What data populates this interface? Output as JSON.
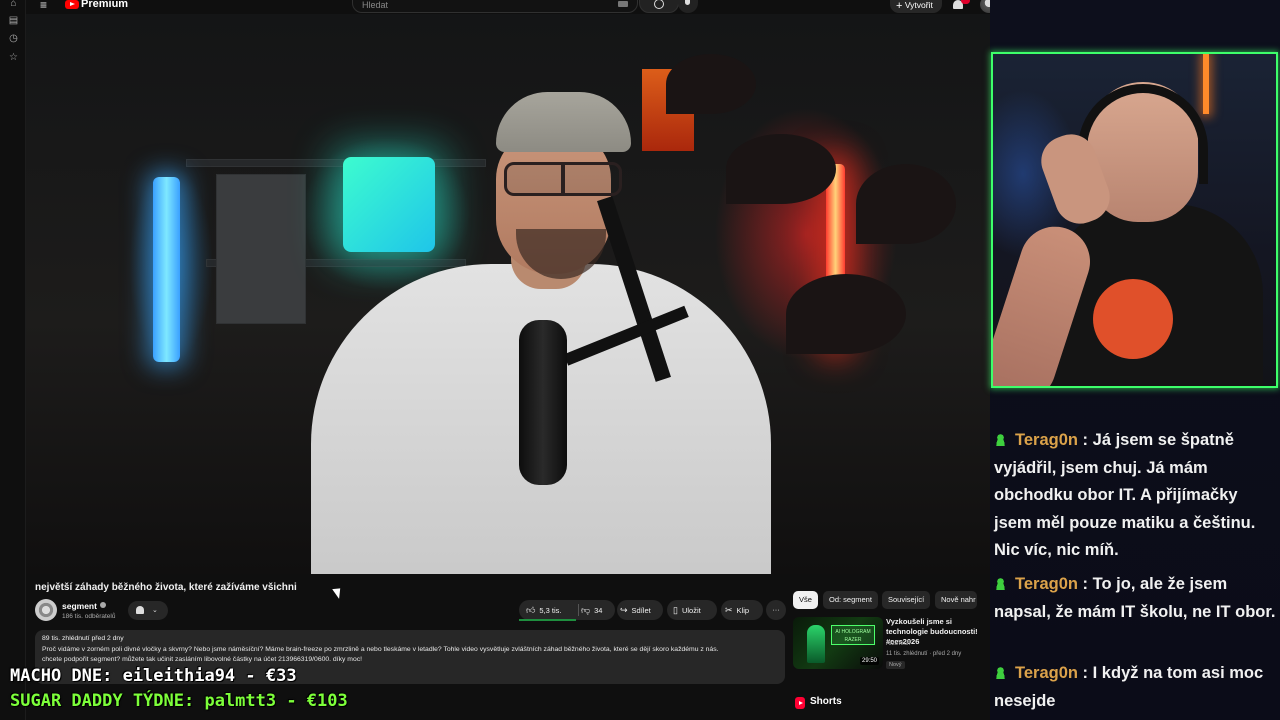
{
  "header": {
    "brand": "Premium",
    "search_placeholder": "Hledat",
    "create_label": "Vytvořit"
  },
  "video": {
    "title": "největší záhady běžného života, které zažíváme všichni",
    "channel": "segment",
    "subscribers": "186 tis. odběratelů",
    "likes": "5,3 tis.",
    "dislikes": "34",
    "share_label": "Sdílet",
    "save_label": "Uložit",
    "clip_label": "Klip",
    "description": {
      "meta": "89 tis. zhlédnutí  před 2 dny",
      "line1": "Proč vidáme v zorném poli divné vločky a skvrny? Nebo jsme náměsíční? Máme brain-freeze po zmrzlině a nebo tleskáme v letadle? Tohle video vysvětluje zvláštních záhad běžného života, které se dějí skoro každému z nás.",
      "line2": "chcete podpořit segment? můžete tak učinit zasláním libovolné částky na účet 213966319/0600. díky moc!"
    }
  },
  "recommendations": {
    "chips": [
      "Vše",
      "Od: segment",
      "Související",
      "Nově nahr"
    ],
    "active_chip": "Vše",
    "items": [
      {
        "title": "Vyzkoušeli jsme si technologie budoucnosti! #ces2026",
        "channel": "AlzaTech",
        "meta": "11 tis. zhlédnutí · před 2 dny",
        "badge": "Nový",
        "duration": "29:50",
        "thumb_text": "AI HOLOGRAM RAZER"
      }
    ],
    "shorts_label": "Shorts"
  },
  "chat": [
    {
      "user": "Terag0n",
      "message": "Já jsem se špatně vyjádřil, jsem chuj. Já mám obchodku obor IT. A přijímačky jsem měl pouze matiku a češtinu. Nic víc, nic míň."
    },
    {
      "user": "Terag0n",
      "message": "To jo, ale že jsem napsal, že mám IT školu, ne IT obor."
    },
    {
      "user": "Terag0n",
      "message": "I když na tom asi moc nesejde"
    }
  ],
  "overlays": {
    "line1": "MACHO DNE: eileithia94 - €33",
    "line2": "SUGAR DADDY TÝDNE: palmtt3 - €103"
  },
  "colors": {
    "accent": "#ff0000",
    "webcam_border": "#3dff6a",
    "chat_user": "#dba24a",
    "overlay_green": "#7dff3a"
  }
}
